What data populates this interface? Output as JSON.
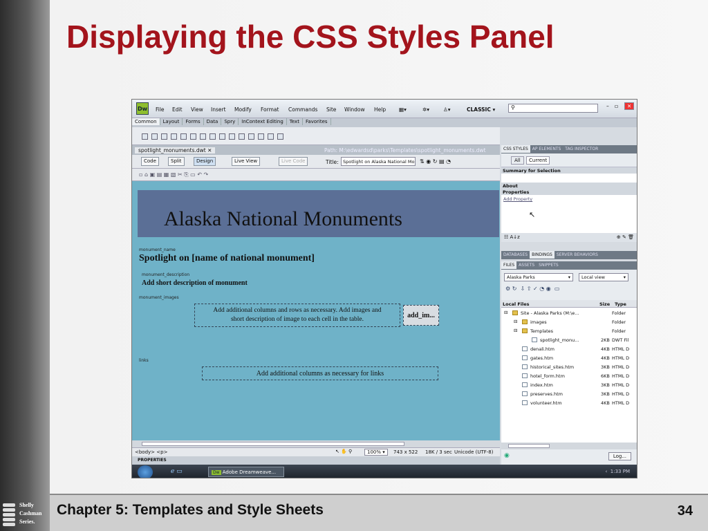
{
  "slide": {
    "title": "Displaying the CSS Styles Panel",
    "footer": "Chapter 5: Templates and Style Sheets",
    "page_number": "34",
    "logo": [
      "Shelly",
      "Cashman",
      "Series."
    ]
  },
  "app": {
    "logo": "Dw",
    "menu": [
      "File",
      "Edit",
      "View",
      "Insert",
      "Modify",
      "Format",
      "Commands",
      "Site",
      "Window",
      "Help"
    ],
    "workspace": "CLASSIC",
    "search_placeholder": "",
    "insert_tabs": [
      "Common",
      "Layout",
      "Forms",
      "Data",
      "Spry",
      "InContext Editing",
      "Text",
      "Favorites"
    ]
  },
  "document": {
    "tab_name": "spotlight_monuments.dwt",
    "path": "Path:  M:\\edwardsd\\parks\\Templates\\spotlight_monuments.dwt",
    "view_buttons": [
      "Code",
      "Split",
      "Design",
      "Live View",
      "Live Code"
    ],
    "title_label": "Title:",
    "title_value": "Spotlight on Alaska National Mo"
  },
  "design": {
    "banner": "Alaska National Monuments",
    "region1_label": "monument_name",
    "heading": "Spotlight on [name of national monument]",
    "region2_label": "monument_description",
    "description": "Add short description of monument",
    "region3_label": "monument_images",
    "images_text_1": "Add additional columns and rows as necessary. Add images and",
    "images_text_2": "short description of image to each cell in the table.",
    "add_images": "add_im...",
    "region4_label": "links",
    "links_text": "Add additional columns as necessary for links"
  },
  "status": {
    "tags": "<body> <p>",
    "zoom": "100%",
    "size": "743 x 522",
    "download": "18K / 3 sec",
    "encoding": "Unicode (UTF-8)",
    "properties": "PROPERTIES"
  },
  "css_panel": {
    "tabs": [
      "CSS STYLES",
      "AP ELEMENTS",
      "TAG INSPECTOR"
    ],
    "mode": [
      "All",
      "Current"
    ],
    "summary": "Summary for Selection",
    "about": "About",
    "properties": "Properties",
    "add_property": "Add Property"
  },
  "db_panel": {
    "tabs": [
      "DATABASES",
      "BINDINGS",
      "SERVER BEHAVIORS"
    ]
  },
  "files_panel": {
    "tabs": [
      "FILES",
      "ASSETS",
      "SNIPPETS"
    ],
    "site": "Alaska Parks",
    "view": "Local view",
    "headers": [
      "Local Files",
      "Size",
      "Type"
    ],
    "rows": [
      {
        "name": "Site - Alaska Parks (M:\\e...",
        "size": "",
        "type": "Folder",
        "kind": "folder",
        "depth": 0
      },
      {
        "name": "images",
        "size": "",
        "type": "Folder",
        "kind": "folder",
        "depth": 1
      },
      {
        "name": "Templates",
        "size": "",
        "type": "Folder",
        "kind": "folder",
        "depth": 1
      },
      {
        "name": "spotlight_monu...",
        "size": "2KB",
        "type": "DWT Fil",
        "kind": "page",
        "depth": 2
      },
      {
        "name": "denali.htm",
        "size": "4KB",
        "type": "HTML D",
        "kind": "page",
        "depth": 1
      },
      {
        "name": "gates.htm",
        "size": "4KB",
        "type": "HTML D",
        "kind": "page",
        "depth": 1
      },
      {
        "name": "historical_sites.htm",
        "size": "3KB",
        "type": "HTML D",
        "kind": "page",
        "depth": 1
      },
      {
        "name": "hotel_form.htm",
        "size": "6KB",
        "type": "HTML D",
        "kind": "page",
        "depth": 1
      },
      {
        "name": "index.htm",
        "size": "3KB",
        "type": "HTML D",
        "kind": "page",
        "depth": 1
      },
      {
        "name": "preserves.htm",
        "size": "3KB",
        "type": "HTML D",
        "kind": "page",
        "depth": 1
      },
      {
        "name": "volunteer.htm",
        "size": "4KB",
        "type": "HTML D",
        "kind": "page",
        "depth": 1
      }
    ],
    "log_button": "Log..."
  },
  "taskbar": {
    "app_button": "Adobe Dreamweave...",
    "time": "1:33 PM"
  }
}
